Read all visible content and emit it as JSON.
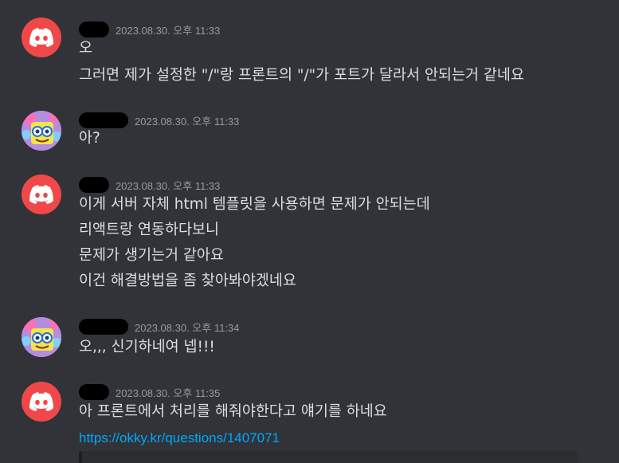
{
  "messages": [
    {
      "timestamp": "2023.08.30. 오후 11:33",
      "avatar": "discord-logo-icon",
      "lines": [
        "오",
        "그러면 제가 설정한 \"/\"랑 프론트의 \"/\"가 포트가 달라서 안되는거 같네요"
      ]
    },
    {
      "timestamp": "2023.08.30. 오후 11:33",
      "avatar": "spongebob-avatar-icon",
      "lines": [
        "아?"
      ]
    },
    {
      "timestamp": "2023.08.30. 오후 11:33",
      "avatar": "discord-logo-icon",
      "lines": [
        "이게 서버 자체 html 템플릿을 사용하면 문제가 안되는데",
        "리액트랑 연동하다보니",
        "문제가 생기는거 같아요",
        "이건 해결방법을 좀 찾아봐야겠네요"
      ]
    },
    {
      "timestamp": "2023.08.30. 오후 11:34",
      "avatar": "spongebob-avatar-icon",
      "lines": [
        "오,,, 신기하네여 넵!!!"
      ]
    },
    {
      "timestamp": "2023.08.30. 오후 11:35",
      "avatar": "discord-logo-icon",
      "lines": [
        "아 프론트에서 처리를 해줘야한다고 얘기를 하네요"
      ],
      "link": "https://okky.kr/questions/1407071"
    }
  ],
  "colors": {
    "background": "#313338",
    "discord_red": "#f04848",
    "link": "#00a8fc",
    "timestamp": "#949ba4",
    "text": "#dbdee1"
  }
}
